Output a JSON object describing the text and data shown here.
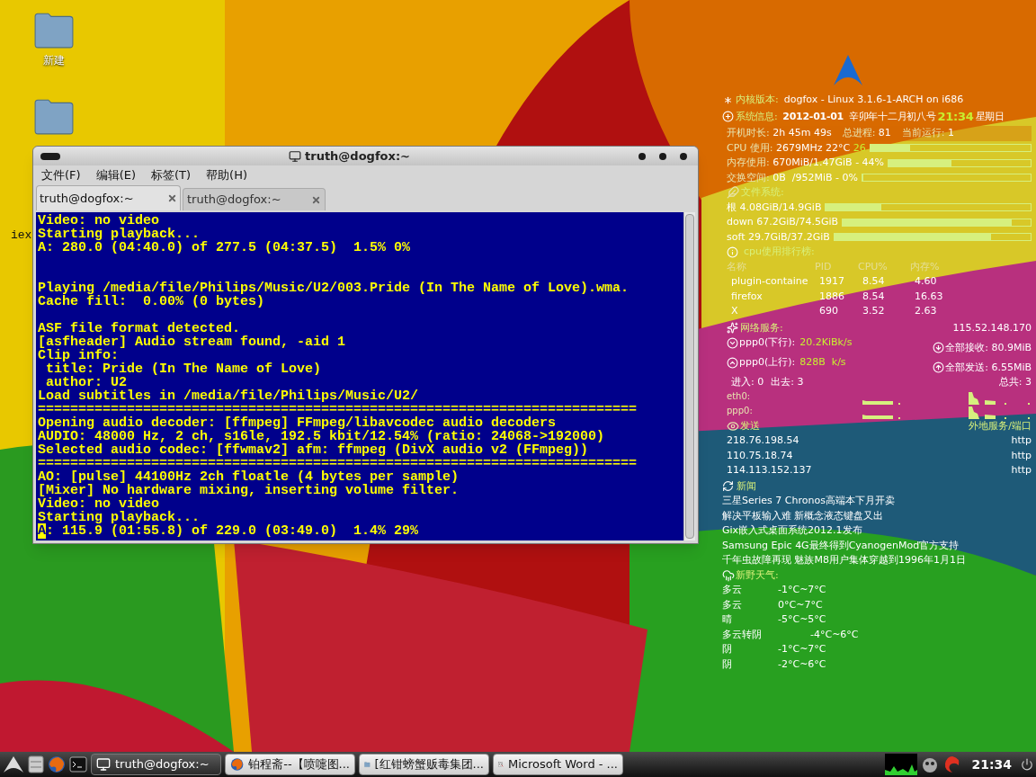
{
  "desktop": {
    "icons": [
      {
        "kind": "labeled",
        "label": "新建"
      },
      {
        "kind": "unlabeled"
      }
    ],
    "edge_text": "iex"
  },
  "terminal": {
    "title": "truth@dogfox:~",
    "menu": [
      "文件(F)",
      "编辑(E)",
      "标签(T)",
      "帮助(H)"
    ],
    "tabs": [
      {
        "label": "truth@dogfox:~",
        "selected": true
      },
      {
        "label": "truth@dogfox:~",
        "selected": false
      }
    ],
    "lines": [
      {
        "kind": "text",
        "text": "Video: no video"
      },
      {
        "kind": "text",
        "text": "Starting playback..."
      },
      {
        "kind": "text",
        "text": "A: 280.0 (04:40.0) of 277.5 (04:37.5)  1.5% 0%"
      },
      {
        "kind": "blank"
      },
      {
        "kind": "blank"
      },
      {
        "kind": "text",
        "text": "Playing /media/file/Philips/Music/U2/003.Pride (In The Name of Love).wma."
      },
      {
        "kind": "text",
        "text": "Cache fill:  0.00% (0 bytes)"
      },
      {
        "kind": "blank"
      },
      {
        "kind": "text",
        "text": "ASF file format detected."
      },
      {
        "kind": "text",
        "text": "[asfheader] Audio stream found, -aid 1"
      },
      {
        "kind": "text",
        "text": "Clip info:"
      },
      {
        "kind": "text",
        "text": " title: Pride (In The Name of Love)"
      },
      {
        "kind": "text",
        "text": " author: U2"
      },
      {
        "kind": "text",
        "text": "Load subtitles in /media/file/Philips/Music/U2/"
      },
      {
        "kind": "text",
        "text": "=========================================================================="
      },
      {
        "kind": "text",
        "text": "Opening audio decoder: [ffmpeg] FFmpeg/libavcodec audio decoders"
      },
      {
        "kind": "text",
        "text": "AUDIO: 48000 Hz, 2 ch, s16le, 192.5 kbit/12.54% (ratio: 24068->192000)"
      },
      {
        "kind": "text",
        "text": "Selected audio codec: [ffwmav2] afm: ffmpeg (DivX audio v2 (FFmpeg))"
      },
      {
        "kind": "text",
        "text": "=========================================================================="
      },
      {
        "kind": "text",
        "text": "AO: [pulse] 44100Hz 2ch floatle (4 bytes per sample)"
      },
      {
        "kind": "text",
        "text": "[Mixer] No hardware mixing, inserting volume filter."
      },
      {
        "kind": "text",
        "text": "Video: no video"
      },
      {
        "kind": "text",
        "text": "Starting playback..."
      },
      {
        "kind": "cursor",
        "text": "A: 115.9 (01:55.8) of 229.0 (03:49.0)  1.4% 29%"
      }
    ]
  },
  "conky": {
    "kernel": {
      "label": "内核版本:",
      "value": "dogfox - Linux 3.1.6-1-ARCH on i686"
    },
    "sysinfo": {
      "label": "系统信息:",
      "date": "2012-01-01",
      "lunar": "辛卯年十二月初八号",
      "time": "21:34",
      "weekday": "星期日"
    },
    "uptime": [
      {
        "label": "开机时长:",
        "value": "2h 45m 49s"
      },
      {
        "label": "总进程:",
        "value": "81"
      },
      {
        "label": "当前运行:",
        "value": "1"
      }
    ],
    "bars": [
      {
        "label": "CPU 使用:",
        "value": "2679MHz 22°C",
        "extra": "26",
        "level": 0.25
      },
      {
        "label": "内存使用:",
        "value": "670MiB/1.47GiB - 44%",
        "level": 0.44
      },
      {
        "label": "交换空间:",
        "value": "0B  /952MiB - 0%",
        "level": 0
      }
    ],
    "fs_title": "文件系统:",
    "fs": [
      {
        "label": "根",
        "value": "4.08GiB/14.9GiB",
        "level": 0.27
      },
      {
        "label": "down",
        "value": "67.2GiB/74.5GiB",
        "level": 0.9
      },
      {
        "label": "soft",
        "value": "29.7GiB/37.2GiB",
        "level": 0.8
      }
    ],
    "cpu_title": "cpu使用排行榜:",
    "cpu_columns": [
      "名称",
      "PID",
      "CPU%",
      "内存%"
    ],
    "cpu_rows": [
      [
        "plugin-containe",
        "1917",
        "8.54",
        "4.60"
      ],
      [
        "firefox",
        "1886",
        "8.54",
        "16.63"
      ],
      [
        "X",
        "690",
        "3.52",
        "2.63"
      ]
    ],
    "net_title": "网络服务:",
    "ip": "115.52.148.170",
    "down": {
      "label": "ppp0(下行):",
      "rate": "20.2KiBk/s",
      "total": "全部接收: 80.9MiB"
    },
    "up": {
      "label": "ppp0(上行):",
      "rate": "828B  k/s",
      "total": "全部发送: 6.55MiB"
    },
    "conn": {
      "in": "进入: 0",
      "out": "出去: 3",
      "total": "总共: 3"
    },
    "graphs": [
      "eth0:",
      "ppp0:"
    ],
    "send_title": "发送",
    "send_right": "外地服务/端口",
    "connections": [
      [
        "218.76.198.54",
        "http"
      ],
      [
        "110.75.18.74",
        "http"
      ],
      [
        "114.113.152.137",
        "http"
      ]
    ],
    "news_title": "新闻",
    "news": [
      "三星Series 7 Chronos高端本下月开卖",
      "解决平板输入难 新概念液态键盘又出",
      "Gix嵌入式桌面系统2012.1发布",
      "Samsung Epic 4G最终得到CyanogenMod官方支持",
      "千年虫故障再现 魅族M8用户集体穿越到1996年1月1日"
    ],
    "weather_title": "新野天气:",
    "weather": [
      [
        "多云",
        "-1°C~7°C"
      ],
      [
        "多云",
        "0°C~7°C"
      ],
      [
        "晴",
        "-5°C~5°C"
      ],
      [
        "多云转阴",
        "-4°C~6°C"
      ],
      [
        "阴",
        "-1°C~7°C"
      ],
      [
        "阴",
        "-2°C~6°C"
      ]
    ]
  },
  "taskbar": {
    "tasks": [
      {
        "kind": "terminal",
        "label": "truth@dogfox:~",
        "selected": true
      },
      {
        "kind": "browser",
        "label": "铂程斋--【喷嚏图...",
        "selected": false
      },
      {
        "kind": "folder",
        "label": "[红钳螃蟹贩毒集团...",
        "selected": false
      },
      {
        "kind": "document",
        "label": "Microsoft Word - ...",
        "selected": false
      }
    ],
    "clock": "21:34"
  }
}
